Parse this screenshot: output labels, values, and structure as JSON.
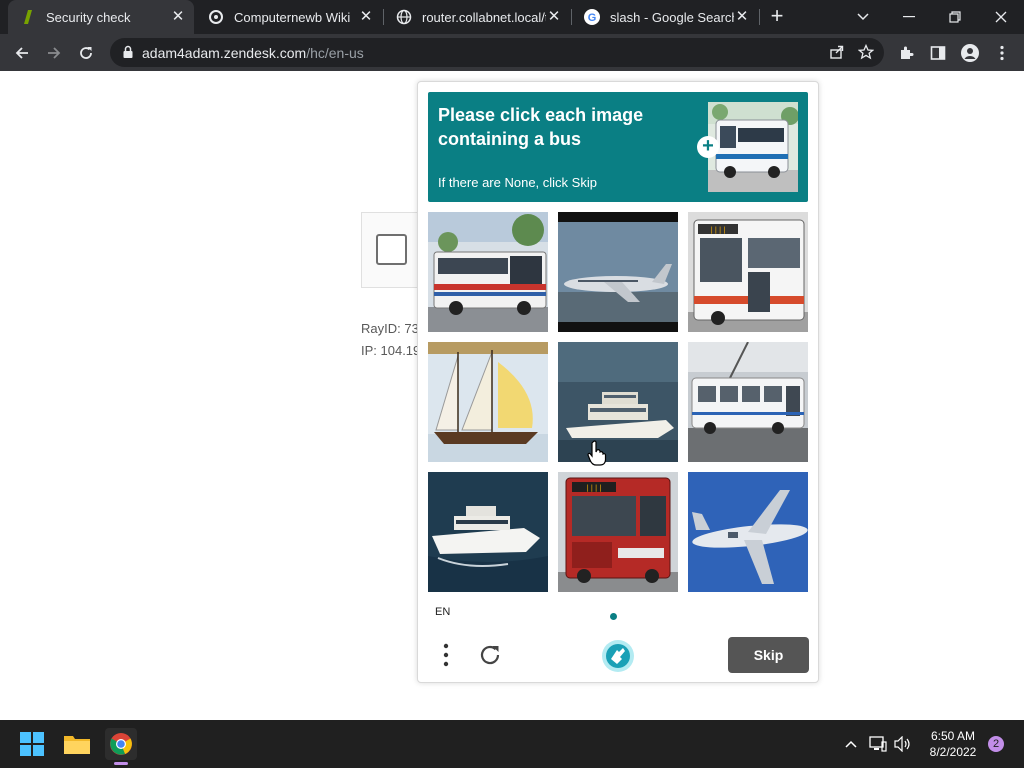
{
  "browser": {
    "tabs": [
      {
        "title": "Security check",
        "icon": "zendesk-icon",
        "active": true
      },
      {
        "title": "Computernewb Wiki",
        "icon": "wiki-icon",
        "active": false
      },
      {
        "title": "router.collabnet.local/t",
        "icon": "globe-icon",
        "active": false
      },
      {
        "title": "slash - Google Search",
        "icon": "google-icon",
        "active": false
      }
    ],
    "tab_close": "✕",
    "new_tab": "+",
    "url_domain": "adam4adam.zendesk.com",
    "url_path": "/hc/en-us"
  },
  "page": {
    "ray_id": "RayID: 73",
    "ip": "IP: 104.19"
  },
  "captcha": {
    "prompt_main": "Please click each image containing a bus",
    "prompt_sub": "If there are None, click Skip",
    "language": "EN",
    "skip_label": "Skip",
    "tiles": [
      {
        "name": "bus-1"
      },
      {
        "name": "airplane-1"
      },
      {
        "name": "bus-2"
      },
      {
        "name": "sailboat"
      },
      {
        "name": "yacht-1"
      },
      {
        "name": "bus-3"
      },
      {
        "name": "yacht-2"
      },
      {
        "name": "bus-4"
      },
      {
        "name": "airplane-2"
      }
    ],
    "accent": "#0a7f84"
  },
  "taskbar": {
    "time": "6:50 AM",
    "date": "8/2/2022",
    "notifications": "2"
  }
}
